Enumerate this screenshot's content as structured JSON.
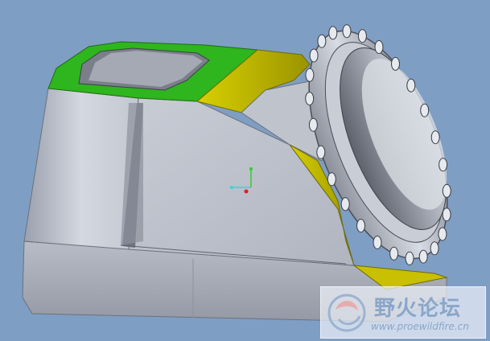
{
  "viewport": {
    "background_color": "#7f9ec4",
    "model_body_color": "#b3b8c4",
    "highlight_green": "#2fb51e",
    "highlight_yellow": "#c8c000"
  },
  "coordinate_triad": {
    "icon": "coordinate-system-icon"
  },
  "watermark": {
    "brand_text": "野火论坛",
    "url_text": "www.proewildfire.cn",
    "icon": "proewildfire-logo-icon"
  }
}
